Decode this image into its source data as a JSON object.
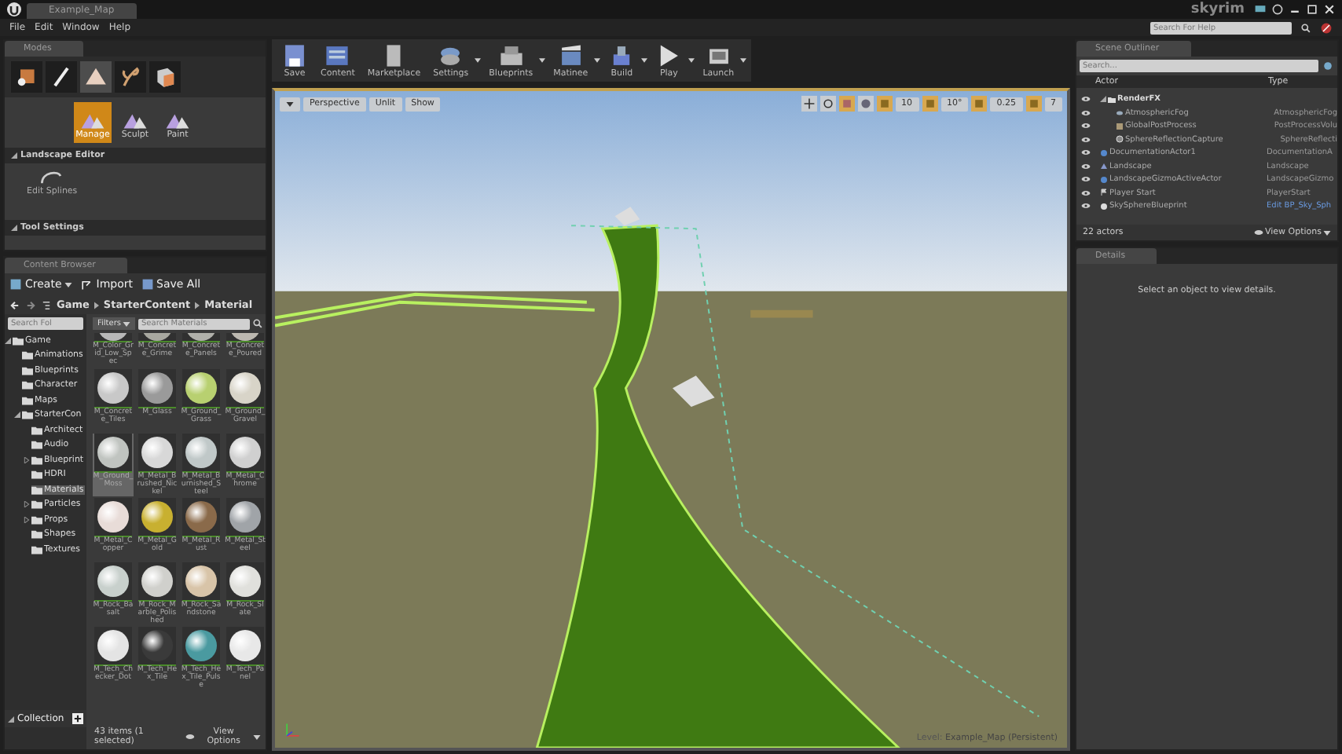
{
  "title_bar": {
    "tab": "Example_Map",
    "project": "skyrim"
  },
  "menu": [
    "File",
    "Edit",
    "Window",
    "Help"
  ],
  "help_search": {
    "placeholder": "Search For Help"
  },
  "modes": {
    "tab": "Modes",
    "mode_tabs": [
      {
        "kind": "place",
        "selected": false
      },
      {
        "kind": "paint",
        "selected": false
      },
      {
        "kind": "landscape",
        "selected": true
      },
      {
        "kind": "foliage",
        "selected": false
      },
      {
        "kind": "geometry",
        "selected": false
      }
    ],
    "landscape_tools": [
      {
        "label": "Manage",
        "selected": true
      },
      {
        "label": "Sculpt",
        "selected": false
      },
      {
        "label": "Paint",
        "selected": false
      }
    ],
    "section_landscape": "Landscape Editor",
    "tool": "Edit Splines",
    "section_tool_settings": "Tool Settings"
  },
  "content_browser": {
    "tab": "Content Browser",
    "create": "Create",
    "import": "Import",
    "save_all": "Save All",
    "path": [
      "Game",
      "StarterContent",
      "Material"
    ],
    "folder_search": {
      "placeholder": "Search Fol"
    },
    "filters": "Filters",
    "asset_search": {
      "placeholder": "Search Materials"
    },
    "tree": [
      {
        "label": "Game",
        "expanded": true,
        "selected": false,
        "children": [
          {
            "label": "Animations",
            "selected": false
          },
          {
            "label": "Blueprints",
            "selected": false
          },
          {
            "label": "Character",
            "selected": false
          },
          {
            "label": "Maps",
            "selected": false
          },
          {
            "label": "StarterCon",
            "expanded": true,
            "selected": false,
            "children": [
              {
                "label": "Architect",
                "selected": false
              },
              {
                "label": "Audio",
                "selected": false
              },
              {
                "label": "Blueprint",
                "expanded": false,
                "selected": false
              },
              {
                "label": "HDRI",
                "selected": false
              },
              {
                "label": "Materials",
                "selected": true
              },
              {
                "label": "Particles",
                "expanded": false,
                "selected": false
              },
              {
                "label": "Props",
                "expanded": false,
                "selected": false
              },
              {
                "label": "Shapes",
                "selected": false
              },
              {
                "label": "Textures",
                "selected": false
              }
            ]
          }
        ]
      }
    ],
    "assets": [
      {
        "label": "M_Color_Grid_Low_Spec",
        "color": "#b8b8b8",
        "selected": false
      },
      {
        "label": "M_Concrete_Grime",
        "color": "#a8a8a0",
        "selected": false
      },
      {
        "label": "M_Concrete_Panels",
        "color": "#b0b0aa",
        "selected": false
      },
      {
        "label": "M_Concrete_Poured",
        "color": "#bcb8b0",
        "selected": false
      },
      {
        "label": "M_Concrete_Tiles",
        "color": "#c8c8c8",
        "selected": false
      },
      {
        "label": "M_Glass",
        "color": "#9a9a9a",
        "selected": false
      },
      {
        "label": "M_Ground_Grass",
        "color": "#b8d070",
        "selected": false
      },
      {
        "label": "M_Ground_Gravel",
        "color": "#d8d4c8",
        "selected": false
      },
      {
        "label": "M_Ground_Moss",
        "color": "#c0c4c0",
        "selected": true
      },
      {
        "label": "M_Metal_Brushed_Nickel",
        "color": "#d8d8d8",
        "selected": false
      },
      {
        "label": "M_Metal_Burnished_Steel",
        "color": "#c0c8c8",
        "selected": false
      },
      {
        "label": "M_Metal_Chrome",
        "color": "#d0d0d0",
        "selected": false
      },
      {
        "label": "M_Metal_Copper",
        "color": "#e8dcd8",
        "selected": false
      },
      {
        "label": "M_Metal_Gold",
        "color": "#c8b030",
        "selected": false
      },
      {
        "label": "M_Metal_Rust",
        "color": "#8a6a4a",
        "selected": false
      },
      {
        "label": "M_Metal_Steel",
        "color": "#a0a4a8",
        "selected": false
      },
      {
        "label": "M_Rock_Basalt",
        "color": "#c8d0cc",
        "selected": false
      },
      {
        "label": "M_Rock_Marble_Polished",
        "color": "#d0d0cc",
        "selected": false
      },
      {
        "label": "M_Rock_Sandstone",
        "color": "#d8c4a8",
        "selected": false
      },
      {
        "label": "M_Rock_Slate",
        "color": "#e0e0dc",
        "selected": false
      },
      {
        "label": "M_Tech_Checker_Dot",
        "color": "#e4e4e4",
        "selected": false
      },
      {
        "label": "M_Tech_Hex_Tile",
        "color": "#3a3a3a",
        "selected": false
      },
      {
        "label": "M_Tech_Hex_Tile_Pulse",
        "color": "#4a9aa0",
        "selected": false
      },
      {
        "label": "M_Tech_Panel",
        "color": "#e8e8e8",
        "selected": false
      }
    ],
    "collections": "Collection",
    "status": "43 items (1 selected)",
    "view_options": "View Options"
  },
  "toolbar": [
    {
      "label": "Save",
      "kind": "save",
      "menu": false
    },
    {
      "label": "Content",
      "kind": "content",
      "menu": false
    },
    {
      "label": "Marketplace",
      "kind": "marketplace",
      "menu": false
    },
    {
      "label": "Settings",
      "kind": "settings",
      "menu": true
    },
    {
      "label": "Blueprints",
      "kind": "blueprints",
      "menu": true
    },
    {
      "label": "Matinee",
      "kind": "matinee",
      "menu": true
    },
    {
      "label": "Build",
      "kind": "build",
      "menu": true
    },
    {
      "label": "Play",
      "kind": "play",
      "menu": true
    },
    {
      "label": "Launch",
      "kind": "launch",
      "menu": true
    }
  ],
  "viewport": {
    "view_buttons": [
      "Perspective",
      "Unlit",
      "Show"
    ],
    "snap_values": [
      "10",
      "10°",
      "0.25",
      "7"
    ],
    "level_label": "Level:",
    "level": "Example_Map (Persistent)"
  },
  "outliner": {
    "tab": "Scene Outliner",
    "search": {
      "placeholder": "Search..."
    },
    "columns": [
      "Actor",
      "Type"
    ],
    "rows": [
      {
        "label": "RenderFX",
        "kind": "folder",
        "expanded": true,
        "children": [
          {
            "label": "AtmosphericFog",
            "type": "AtmosphericFog",
            "kind": "fog"
          },
          {
            "label": "GlobalPostProcess",
            "type": "PostProcessVolu",
            "kind": "volume"
          },
          {
            "label": "SphereReflectionCapture",
            "type": "SphereReflecti",
            "kind": "capture"
          }
        ]
      },
      {
        "label": "DocumentationActor1",
        "type": "DocumentationA",
        "kind": "doc"
      },
      {
        "label": "Landscape",
        "type": "Landscape",
        "kind": "landscape"
      },
      {
        "label": "LandscapeGizmoActiveActor",
        "type": "LandscapeGizmo",
        "kind": "doc"
      },
      {
        "label": "Player Start",
        "type": "PlayerStart",
        "kind": "player"
      },
      {
        "label": "SkySphereBlueprint",
        "type": "Edit BP_Sky_Sph",
        "kind": "sky"
      }
    ],
    "count": "22 actors",
    "view_options": "View Options"
  },
  "details": {
    "tab": "Details",
    "message": "Select an object to view details."
  }
}
